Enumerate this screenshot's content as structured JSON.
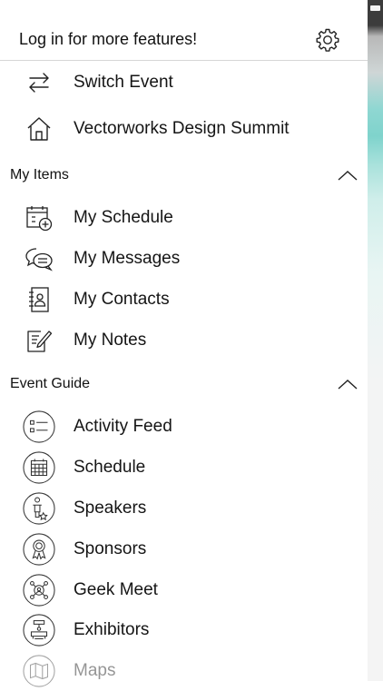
{
  "header": {
    "title": "Log in for more features!",
    "settings_icon": "gear-icon"
  },
  "top_items": [
    {
      "label": "Switch Event",
      "icon": "switch-arrows-icon"
    },
    {
      "label": "Vectorworks Design Summit",
      "icon": "home-icon"
    }
  ],
  "my_items": {
    "title": "My Items",
    "expanded": true,
    "items": [
      {
        "label": "My Schedule",
        "icon": "calendar-add-icon"
      },
      {
        "label": "My Messages",
        "icon": "chat-bubbles-icon"
      },
      {
        "label": "My Contacts",
        "icon": "address-book-icon"
      },
      {
        "label": "My Notes",
        "icon": "note-edit-icon"
      }
    ]
  },
  "event_guide": {
    "title": "Event Guide",
    "expanded": true,
    "items": [
      {
        "label": "Activity Feed",
        "icon": "list-icon"
      },
      {
        "label": "Schedule",
        "icon": "calendar-grid-icon"
      },
      {
        "label": "Speakers",
        "icon": "speaker-podium-icon"
      },
      {
        "label": "Sponsors",
        "icon": "ribbon-badge-icon"
      },
      {
        "label": "Geek Meet",
        "icon": "network-people-icon"
      },
      {
        "label": "Exhibitors",
        "icon": "booth-icon"
      },
      {
        "label": "Maps",
        "icon": "map-icon"
      }
    ]
  }
}
